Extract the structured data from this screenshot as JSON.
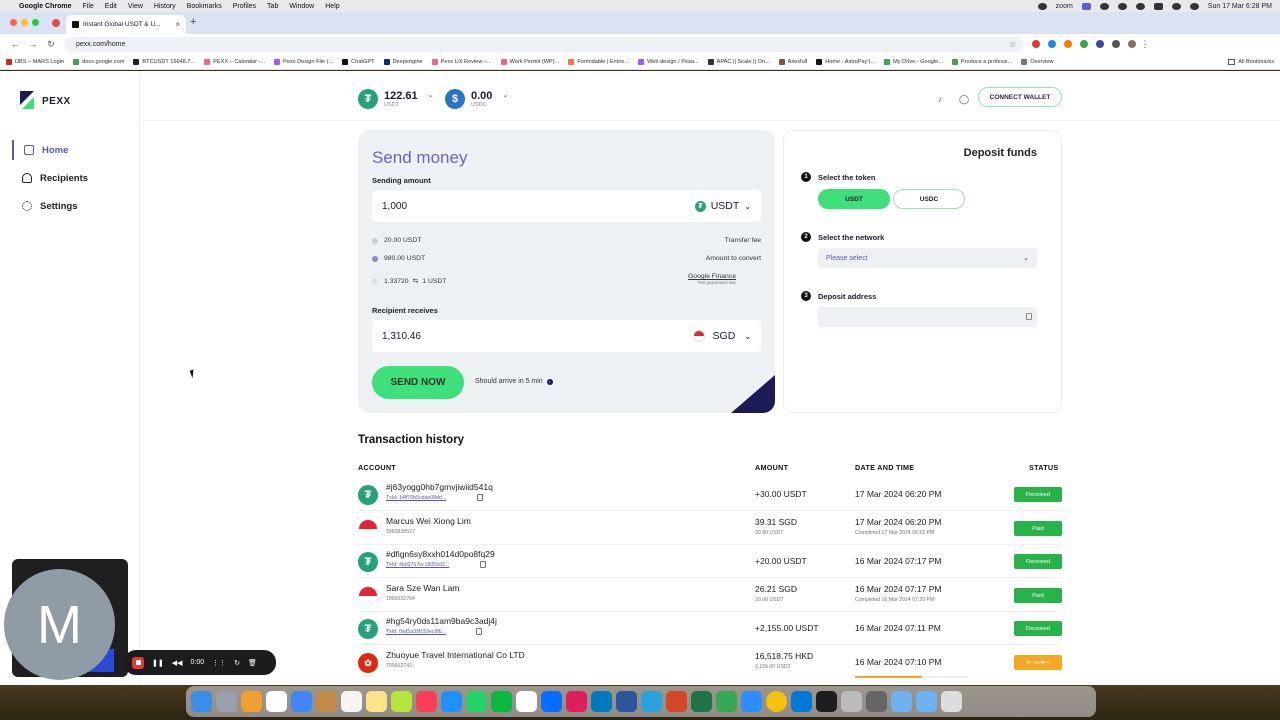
{
  "menubar": {
    "app": "Google Chrome",
    "items": [
      "File",
      "Edit",
      "View",
      "History",
      "Bookmarks",
      "Profiles",
      "Tab",
      "Window",
      "Help"
    ],
    "zoom_label": "zoom",
    "clock": "Sun 17 Mar 6:28 PM"
  },
  "browser": {
    "tab_title": "Instant Global USDT & U...",
    "url": "pexx.com/home",
    "bookmarks": [
      {
        "label": "DBS – MARS Login",
        "color": "#c62828"
      },
      {
        "label": "docs.google.com",
        "color": "#34a853"
      },
      {
        "label": "BTCUSDT 16648.7...",
        "color": "#222222"
      },
      {
        "label": "PEXX – Calendar -...",
        "color": "#f06292"
      },
      {
        "label": "Pexx Design File (...",
        "color": "#a259ff"
      },
      {
        "label": "ChatGPT",
        "color": "#111111"
      },
      {
        "label": "Deepengine",
        "color": "#1a237e"
      },
      {
        "label": "Pexx UX Review –...",
        "color": "#f06292"
      },
      {
        "label": "Work Permit (WP)...",
        "color": "#f06292"
      },
      {
        "label": "Formidable | Entrie...",
        "color": "#ff7043"
      },
      {
        "label": "Web design / Pexa...",
        "color": "#a259ff"
      },
      {
        "label": "APAC || Scale || On...",
        "color": "#333333"
      },
      {
        "label": "Axesfull",
        "color": "#795548"
      },
      {
        "label": "Home - AstroPay |...",
        "color": "#111111"
      },
      {
        "label": "My Drive - Google...",
        "color": "#34a853"
      },
      {
        "label": "Produce a professi...",
        "color": "#43a047"
      },
      {
        "label": "Overview",
        "color": "#777777"
      }
    ],
    "all_bookmarks": "All Bookmarks"
  },
  "brand": {
    "name": "PEXX",
    "accent": "#5b55c9",
    "green": "#3fe07b",
    "navy": "#1b1b57"
  },
  "sidebar": {
    "items": [
      {
        "label": "Home",
        "icon": "home-icon"
      },
      {
        "label": "Recipients",
        "icon": "people-icon"
      },
      {
        "label": "Settings",
        "icon": "gear-icon"
      }
    ]
  },
  "header": {
    "balances": [
      {
        "amount": "122.61",
        "currency": "USDT"
      },
      {
        "amount": "0.00",
        "currency": "USDC"
      }
    ],
    "connect_wallet": "CONNECT WALLET"
  },
  "send": {
    "title": "Send money",
    "sending_label": "Sending amount",
    "sending_value": "1,000",
    "sending_currency": "USDT",
    "fee_amount": "20.00 USDT",
    "fee_label": "Transfer fee",
    "convert_amount": "980.00 USDT",
    "convert_label": "Amount to convert",
    "rate": "1.33720",
    "rate_unit": "1 USDT",
    "rate_source": "Google Finance",
    "rate_note": "*Not guaranteed rate",
    "recipient_label": "Recipient receives",
    "recipient_value": "1,310.46",
    "recipient_currency": "SGD",
    "button": "SEND NOW",
    "eta": "Should arrive in 5 min"
  },
  "deposit": {
    "title": "Deposit funds",
    "step1": "Select the token",
    "token_a": "USDT",
    "token_b": "USDC",
    "step2": "Select the network",
    "network_placeholder": "Please select",
    "step3": "Deposit address"
  },
  "transactions": {
    "title": "Transaction history",
    "columns": {
      "account": "ACCOUNT",
      "amount": "AMOUNT",
      "date": "DATE AND TIME",
      "status": "STATUS"
    },
    "rows": [
      {
        "icon": "usdt",
        "account": "#j63yogg0hb7gmvjiwiid541q",
        "sub": "TxId: 14ff70b5cdae08dd...",
        "link": true,
        "amount": "+30.00 USDT",
        "amount2": "",
        "date": "17 Mar 2024 06:20 PM",
        "date2": "",
        "status": "Received",
        "status_type": "received"
      },
      {
        "icon": "sg",
        "account": "Marcus Wei Xiong Lim",
        "sub": "3983838527",
        "link": false,
        "amount": "39.31 SGD",
        "amount2": "30.00 USDT",
        "date": "17 Mar 2024 06:20 PM",
        "date2": "Completed 17 Mar 2024 06:22 PM",
        "status": "Paid",
        "status_type": "paid"
      },
      {
        "icon": "usdt",
        "account": "#dfign6sy8xxh014d0po8fq29",
        "sub": "TxId: 4bd2767ec18056d2...",
        "link": true,
        "amount": "+20.00 USDT",
        "amount2": "",
        "date": "16 Mar 2024 07:17 PM",
        "date2": "",
        "status": "Received",
        "status_type": "received"
      },
      {
        "icon": "sg",
        "account": "Sara Sze Wan Lam",
        "sub": "1090032764",
        "link": false,
        "amount": "26.21 SGD",
        "amount2": "20.00 USDT",
        "date": "16 Mar 2024 07:17 PM",
        "date2": "Completed 16 Mar 2024 07:20 PM",
        "status": "Paid",
        "status_type": "paid"
      },
      {
        "icon": "usdt",
        "account": "#hg54ry0ds11am9ba9c3adj4j",
        "sub": "TxId: 0xd5a39f153ec9fb...",
        "link": true,
        "amount": "+2,155.00 USDT",
        "amount2": "",
        "date": "16 Mar 2024 07:11 PM",
        "date2": "",
        "status": "Received",
        "status_type": "received"
      },
      {
        "icon": "hk",
        "account": "Zhuoyue Travel International Co LTD",
        "sub": "799662742",
        "link": false,
        "amount": "16,518.75 HKD",
        "amount2": "2,155.00 USDT",
        "date": "16 Mar 2024 07:10 PM",
        "date2": "",
        "status": "In review",
        "status_type": "review",
        "progress": 0.6
      }
    ]
  },
  "recorder": {
    "avatar_letter": "M",
    "time": "0:00"
  }
}
